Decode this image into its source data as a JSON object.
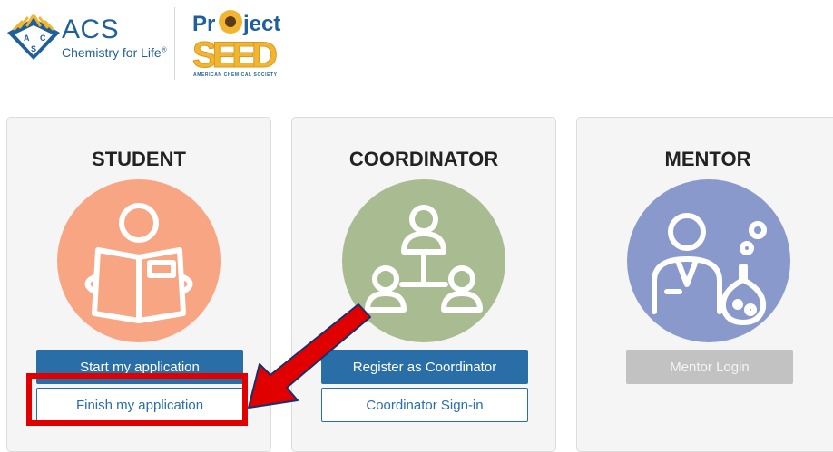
{
  "header": {
    "acs_name": "ACS",
    "acs_tagline": "Chemistry for Life",
    "acs_tagline_mark": "®",
    "acs_letters": [
      "A",
      "C",
      "S"
    ],
    "project_word_left": "Pr",
    "project_word_right": "ject",
    "seed_word": "SEED",
    "seed_subtitle": "AMERICAN CHEMICAL SOCIETY"
  },
  "cards": {
    "student": {
      "title": "STUDENT",
      "icon": "reading-student-icon",
      "color": "#f7a583",
      "primary_label": "Start my application",
      "secondary_label": "Finish my application"
    },
    "coordinator": {
      "title": "COORDINATOR",
      "icon": "org-chart-people-icon",
      "color": "#a8bb91",
      "primary_label": "Register as Coordinator",
      "secondary_label": "Coordinator Sign-in"
    },
    "mentor": {
      "title": "MENTOR",
      "icon": "scientist-flask-icon",
      "color": "#8a99cc",
      "primary_label": "Mentor Login"
    }
  },
  "colors": {
    "button_blue": "#2a6ea8",
    "annotation_red": "#e00000",
    "acs_blue": "#1f5f9c"
  }
}
